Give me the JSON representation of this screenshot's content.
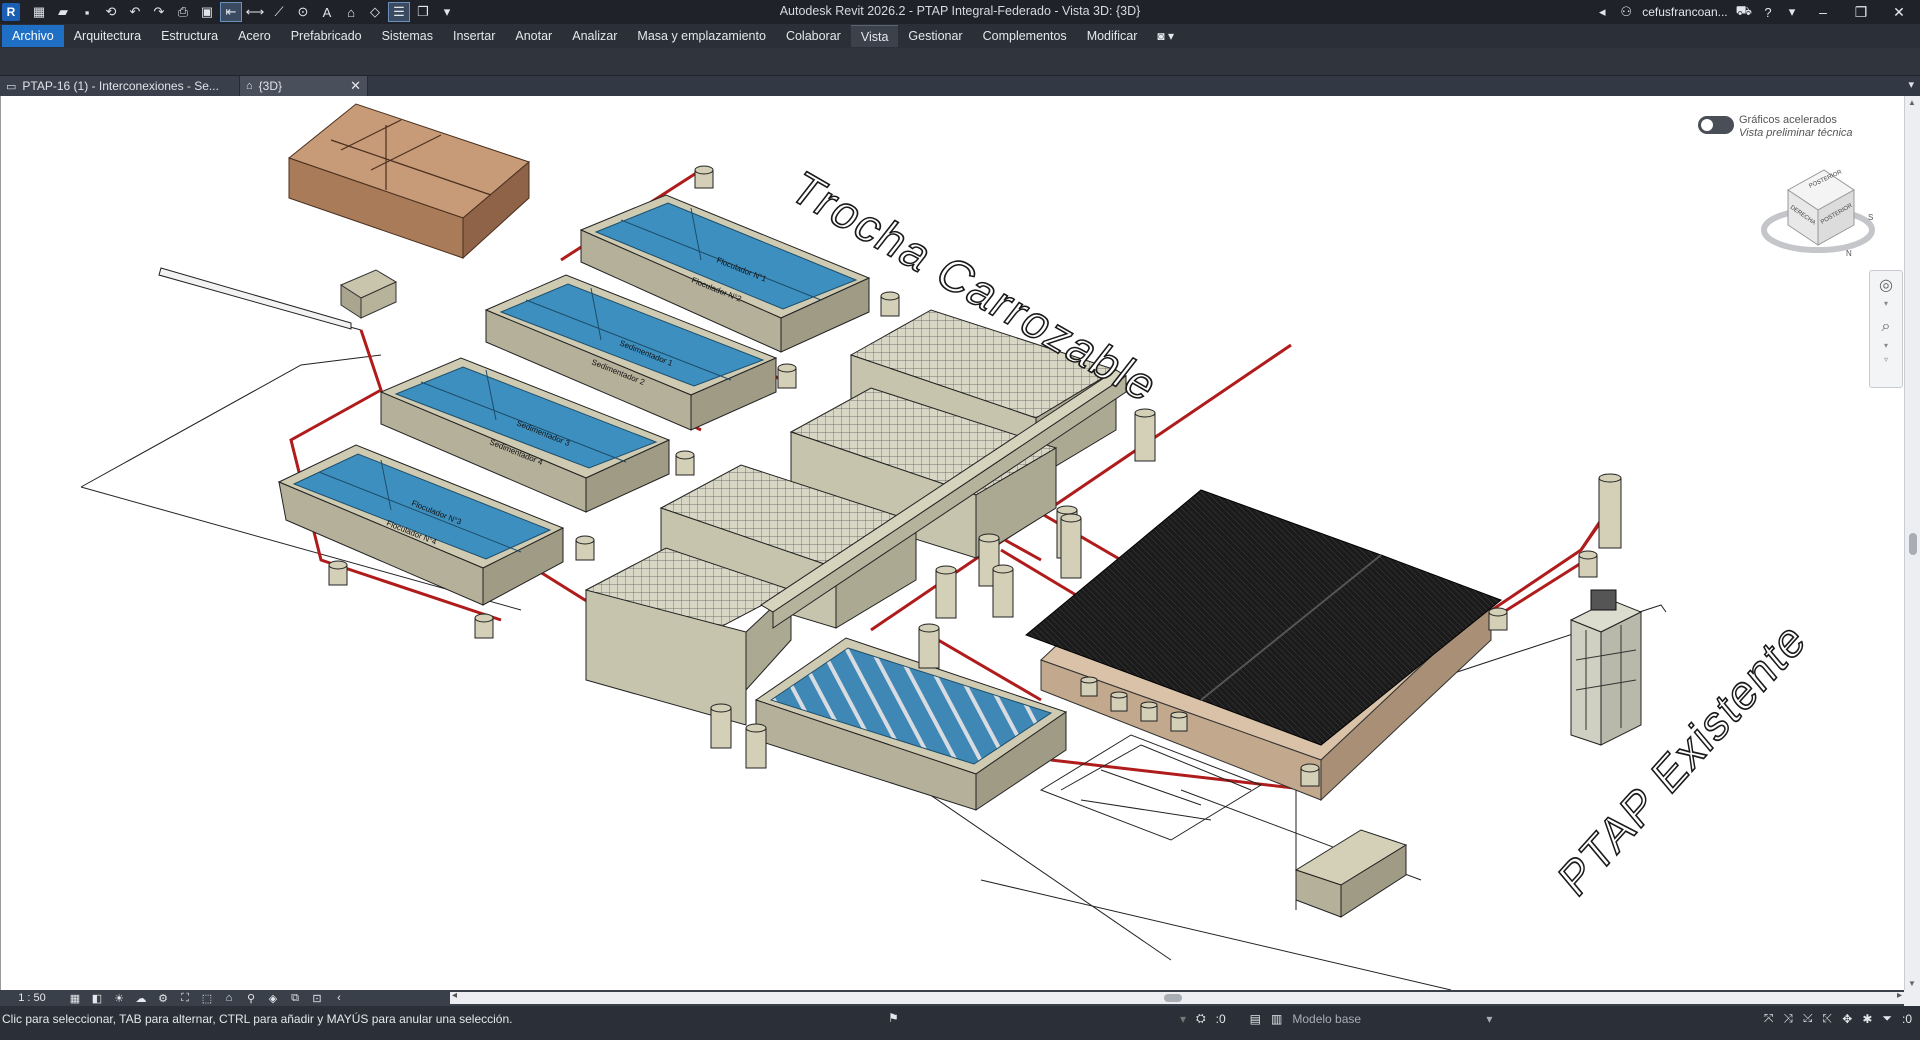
{
  "window": {
    "title": "Autodesk Revit 2026.2 - PTAP Integral-Federado - Vista 3D: {3D}",
    "user": "cefusfrancoan...",
    "logo_letter": "R"
  },
  "menu": {
    "items": [
      "Archivo",
      "Arquitectura",
      "Estructura",
      "Acero",
      "Prefabricado",
      "Sistemas",
      "Insertar",
      "Anotar",
      "Analizar",
      "Masa y emplazamiento",
      "Colaborar",
      "Vista",
      "Gestionar",
      "Complementos",
      "Modificar"
    ],
    "active": "Vista",
    "extra_icon": "camera-icon"
  },
  "tabs": [
    {
      "label": "PTAP-16 (1) - Interconexiones - Se...",
      "icon": "floorplan-icon",
      "active": false
    },
    {
      "label": "{3D}",
      "icon": "home-icon",
      "active": true
    }
  ],
  "canvas": {
    "graphics_toggle": {
      "line1": "Gráficos acelerados",
      "line2": "Vista preliminar técnica",
      "on": false
    },
    "labels": {
      "road": "Trocha Carrozable",
      "existing": "PTAP Existente"
    },
    "viewcube": {
      "top": "POSTERIOR",
      "left": "DERECHA",
      "front": "POSTERIOR",
      "compass_n": "N",
      "compass_s": "S"
    },
    "filter_labels": [
      "Floculador N°1",
      "Floculador N°2",
      "Sedimentador 1",
      "Sedimentador 2",
      "Sedimentador 3",
      "Sedimentador 4",
      "Floculador N°3",
      "Floculador N°4"
    ],
    "colors": {
      "water": "#3d8fbf",
      "concrete": "#d4d0b8",
      "pipe": "#b01c1c",
      "roof": "#1b1b1b",
      "brick": "#b58a66"
    }
  },
  "viewbar": {
    "scale": "1 : 50"
  },
  "status": {
    "message": "Clic para seleccionar, TAB para alternar, CTRL para añadir y MAYÚS para anular una selección.",
    "worksets": ":0",
    "model": "Modelo base",
    "filter_count": ":0"
  }
}
